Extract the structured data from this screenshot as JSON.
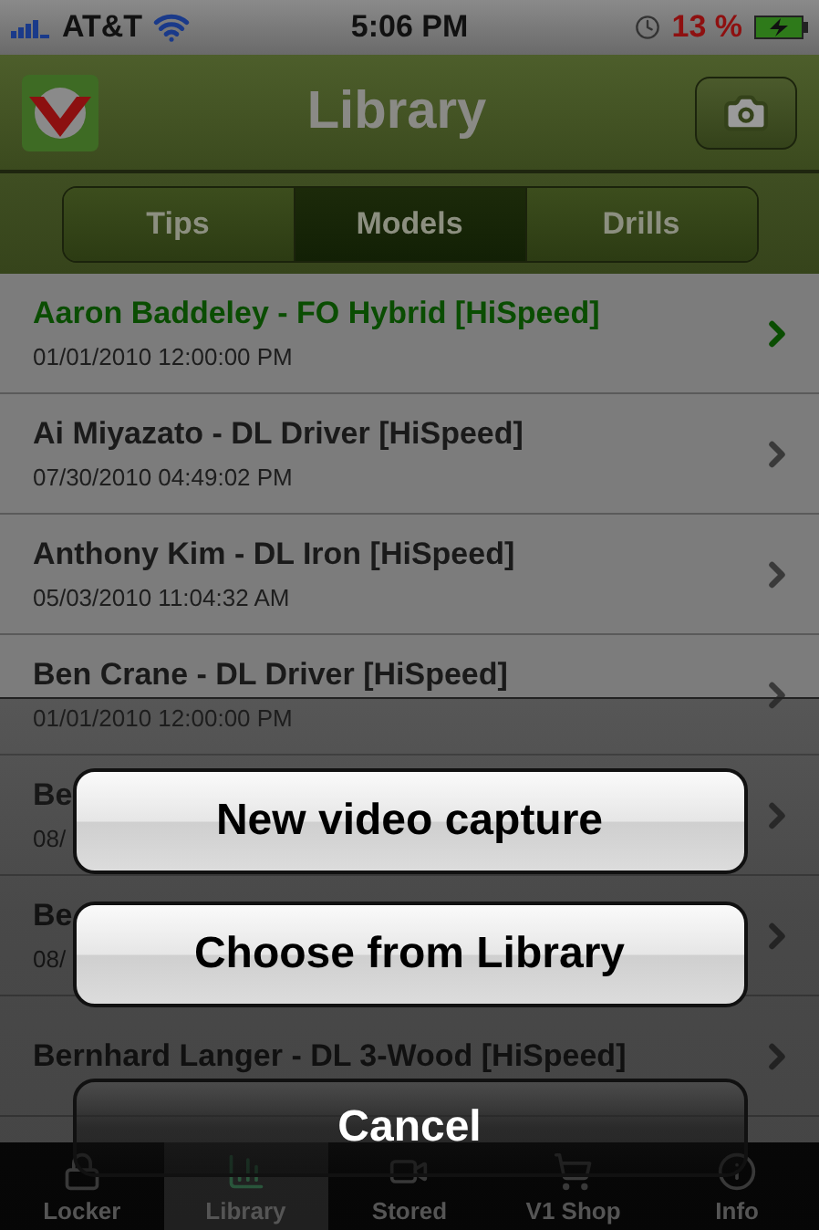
{
  "status_bar": {
    "carrier": "AT&T",
    "time": "5:06 PM",
    "battery": "13 %"
  },
  "nav_bar": {
    "title": "Library"
  },
  "segments": [
    {
      "label": "Tips",
      "selected": false
    },
    {
      "label": "Models",
      "selected": true
    },
    {
      "label": "Drills",
      "selected": false
    }
  ],
  "rows": [
    {
      "title": "Aaron Baddeley - FO Hybrid [HiSpeed]",
      "date": "01/01/2010 12:00:00 PM",
      "selected": true
    },
    {
      "title": "Ai Miyazato - DL Driver [HiSpeed]",
      "date": "07/30/2010 04:49:02 PM",
      "selected": false
    },
    {
      "title": "Anthony Kim - DL Iron [HiSpeed]",
      "date": "05/03/2010 11:04:32 AM",
      "selected": false
    },
    {
      "title": "Ben Crane - DL Driver [HiSpeed]",
      "date": "01/01/2010 12:00:00 PM",
      "selected": false
    },
    {
      "title": "Be",
      "date": "08/",
      "selected": false
    },
    {
      "title": "Be",
      "date": "08/",
      "selected": false
    },
    {
      "title": "Bernhard Langer - DL 3-Wood [HiSpeed]",
      "selected": false
    }
  ],
  "action_sheet": {
    "buttons": [
      {
        "label": "New video capture",
        "kind": "default"
      },
      {
        "label": "Choose from Library",
        "kind": "default"
      },
      {
        "label": "Cancel",
        "kind": "cancel"
      }
    ]
  },
  "tab_bar": [
    {
      "label": "Locker",
      "selected": false
    },
    {
      "label": "Library",
      "selected": true
    },
    {
      "label": "Stored",
      "selected": false
    },
    {
      "label": "V1 Shop",
      "selected": false
    },
    {
      "label": "Info",
      "selected": false
    }
  ]
}
